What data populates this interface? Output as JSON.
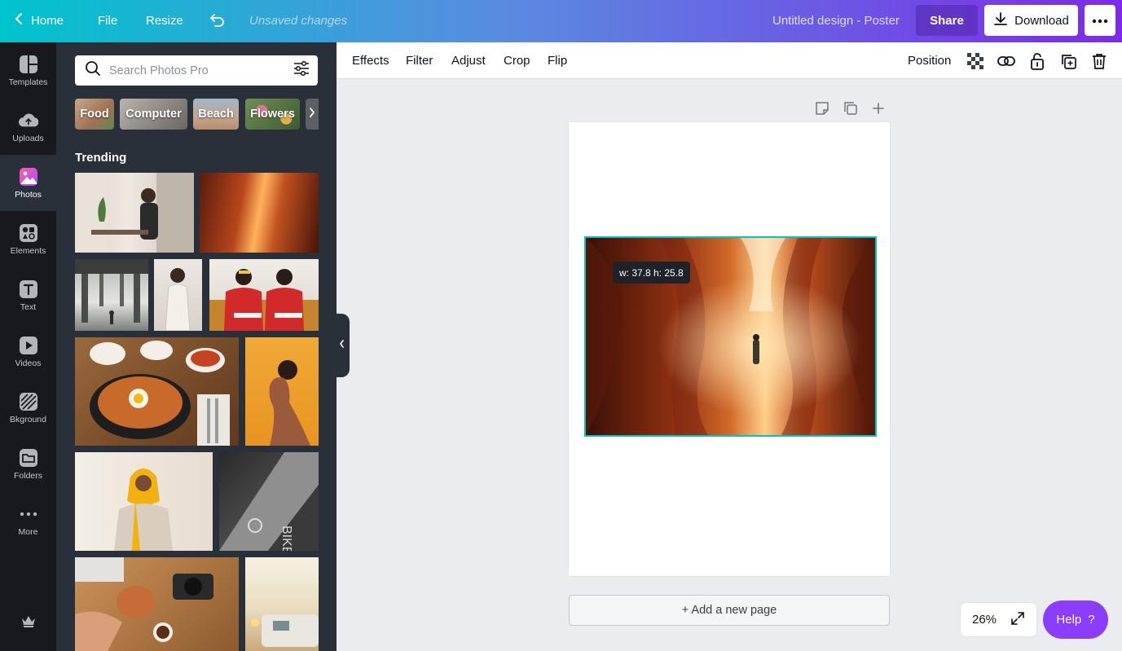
{
  "topbar": {
    "home_label": "Home",
    "file_label": "File",
    "resize_label": "Resize",
    "undo_icon": "undo-icon",
    "unsaved_text": "Unsaved changes",
    "design_title": "Untitled design - Poster",
    "share_label": "Share",
    "download_label": "Download",
    "more_icon": "more-horizontal-icon"
  },
  "rail": {
    "items": [
      {
        "label": "Templates",
        "icon": "templates-icon"
      },
      {
        "label": "Uploads",
        "icon": "upload-cloud-icon"
      },
      {
        "label": "Photos",
        "icon": "photos-icon",
        "active": true
      },
      {
        "label": "Elements",
        "icon": "elements-icon"
      },
      {
        "label": "Text",
        "icon": "text-icon"
      },
      {
        "label": "Videos",
        "icon": "videos-icon"
      },
      {
        "label": "Bkground",
        "icon": "background-icon"
      },
      {
        "label": "Folders",
        "icon": "folders-icon"
      },
      {
        "label": "More",
        "icon": "more-icon"
      }
    ],
    "premium_icon": "crown-icon"
  },
  "panel": {
    "search_placeholder": "Search Photos Pro",
    "chips": [
      "Food",
      "Computer",
      "Beach",
      "Flowers"
    ],
    "section_title": "Trending"
  },
  "toolbar": {
    "effects_label": "Effects",
    "filter_label": "Filter",
    "adjust_label": "Adjust",
    "crop_label": "Crop",
    "flip_label": "Flip",
    "position_label": "Position"
  },
  "canvas": {
    "size_tooltip": "w: 37.8 h: 25.8",
    "add_page_label": "+ Add a new page"
  },
  "footer": {
    "zoom_level": "26%",
    "help_label": "Help",
    "help_symbol": "?"
  },
  "colors": {
    "accent_teal": "#00c4cc",
    "accent_purple": "#7d2ae8",
    "help_purple": "#8b3dff",
    "sidebar_dark": "#18191f",
    "panel_dark": "#293039"
  }
}
